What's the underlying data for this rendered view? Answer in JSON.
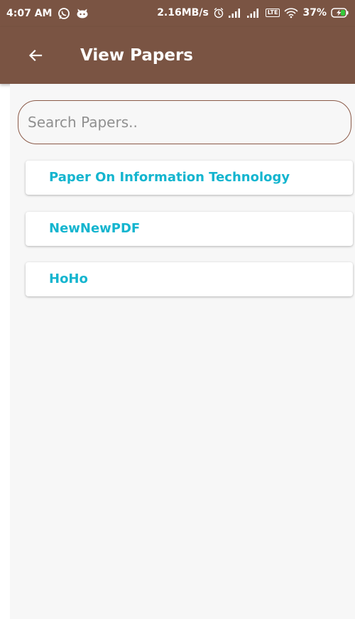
{
  "status_bar": {
    "time": "4:07 AM",
    "network_speed": "2.16MB/s",
    "battery_percent": "37%",
    "network_type": "LTE",
    "icons": [
      "whatsapp-icon",
      "notification-app-icon",
      "alarm-icon",
      "signal-icon",
      "signal-icon",
      "volte-icon",
      "wifi-icon",
      "battery-charging-icon"
    ]
  },
  "toolbar": {
    "title": "View Papers",
    "back_icon": "arrow-left-icon"
  },
  "search": {
    "placeholder": "Search Papers..",
    "value": ""
  },
  "papers": [
    {
      "title": "Paper On Information Technology"
    },
    {
      "title": "NewNewPDF"
    },
    {
      "title": "HoHo"
    }
  ],
  "colors": {
    "primary": "#7a5443",
    "accent_text": "#14b5cf",
    "background": "#f7f7f7"
  }
}
